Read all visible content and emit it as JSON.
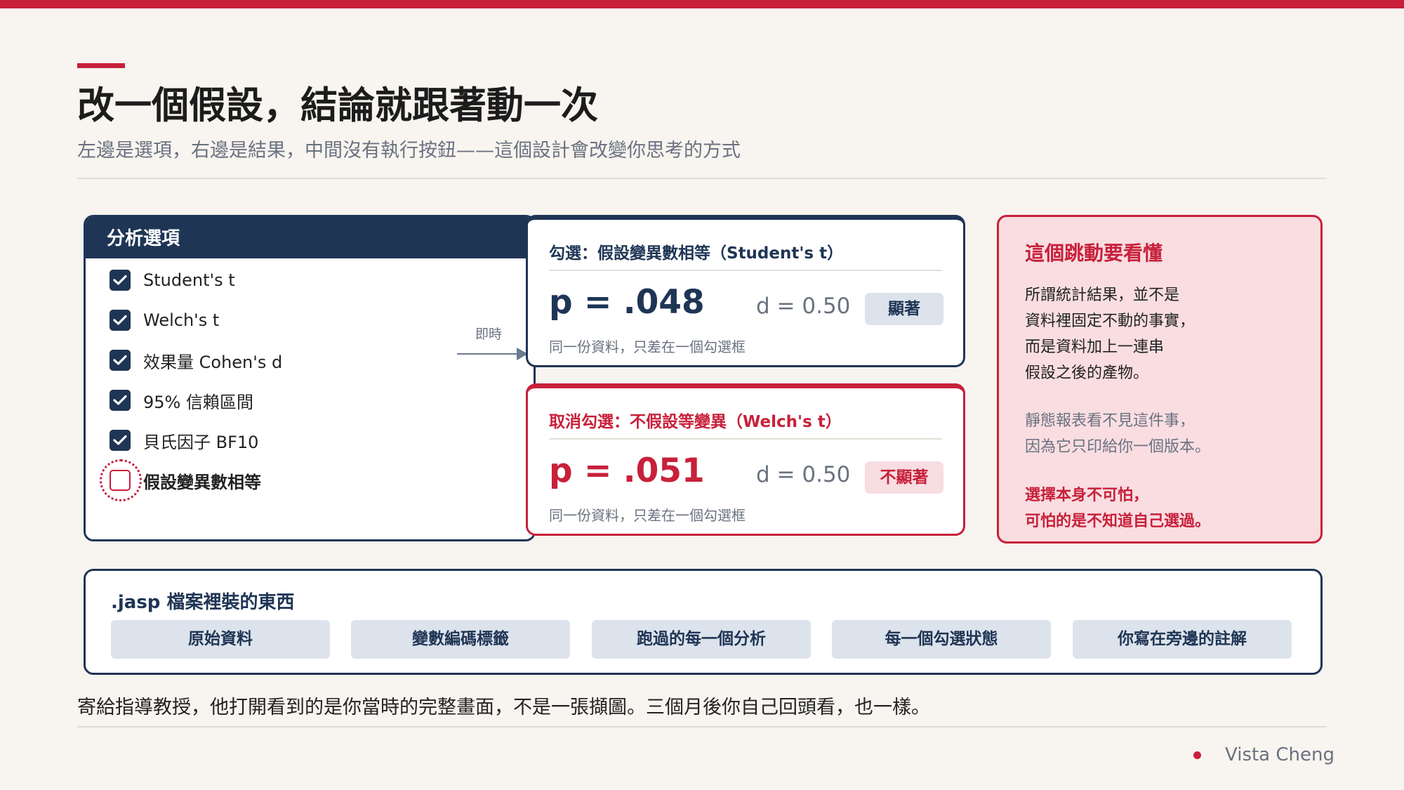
{
  "header": {
    "title": "改一個假設，結論就跟著動一次",
    "subtitle": "左邊是選項，右邊是結果，中間沒有執行按鈕——這個設計會改變你思考的方式"
  },
  "options": {
    "heading": "分析選項",
    "items": [
      {
        "label": "Student's t",
        "checked": true
      },
      {
        "label": "Welch's t",
        "checked": true
      },
      {
        "label": "效果量 Cohen's d",
        "checked": true
      },
      {
        "label": "95% 信賴區間",
        "checked": true
      },
      {
        "label": "貝氏因子 BF10",
        "checked": true
      },
      {
        "label": "假設變異數相等",
        "checked": false
      }
    ]
  },
  "arrow": {
    "label": "即時"
  },
  "results": [
    {
      "title": "勾選：假設變異數相等（Student's t）",
      "p": "p = .048",
      "d": "d = 0.50",
      "badge": "顯著",
      "note": "同一份資料，只差在一個勾選框"
    },
    {
      "title": "取消勾選：不假設等變異（Welch's t）",
      "p": "p = .051",
      "d": "d = 0.50",
      "badge": "不顯著",
      "note": "同一份資料，只差在一個勾選框"
    }
  ],
  "explain": {
    "title": "這個跳動要看懂",
    "para1": [
      "所謂統計結果，並不是",
      "資料裡固定不動的事實，",
      "而是資料加上一連串",
      "假設之後的產物。"
    ],
    "para2": [
      "靜態報表看不見這件事，",
      "因為它只印給你一個版本。"
    ],
    "para3": [
      "選擇本身不可怕，",
      "可怕的是不知道自己選過。"
    ]
  },
  "jasp": {
    "title": ".jasp 檔案裡裝的東西",
    "items": [
      "原始資料",
      "變數編碼標籤",
      "跑過的每一個分析",
      "每一個勾選狀態",
      "你寫在旁邊的註解"
    ]
  },
  "bottom_text": "寄給指導教授，他打開看到的是你當時的完整畫面，不是一張擷圖。三個月後你自己回頭看，也一樣。",
  "footer": {
    "author": "Vista Cheng"
  },
  "colors": {
    "accent": "#c8203a",
    "navy": "#1f3555",
    "background": "#f8f4ef"
  }
}
